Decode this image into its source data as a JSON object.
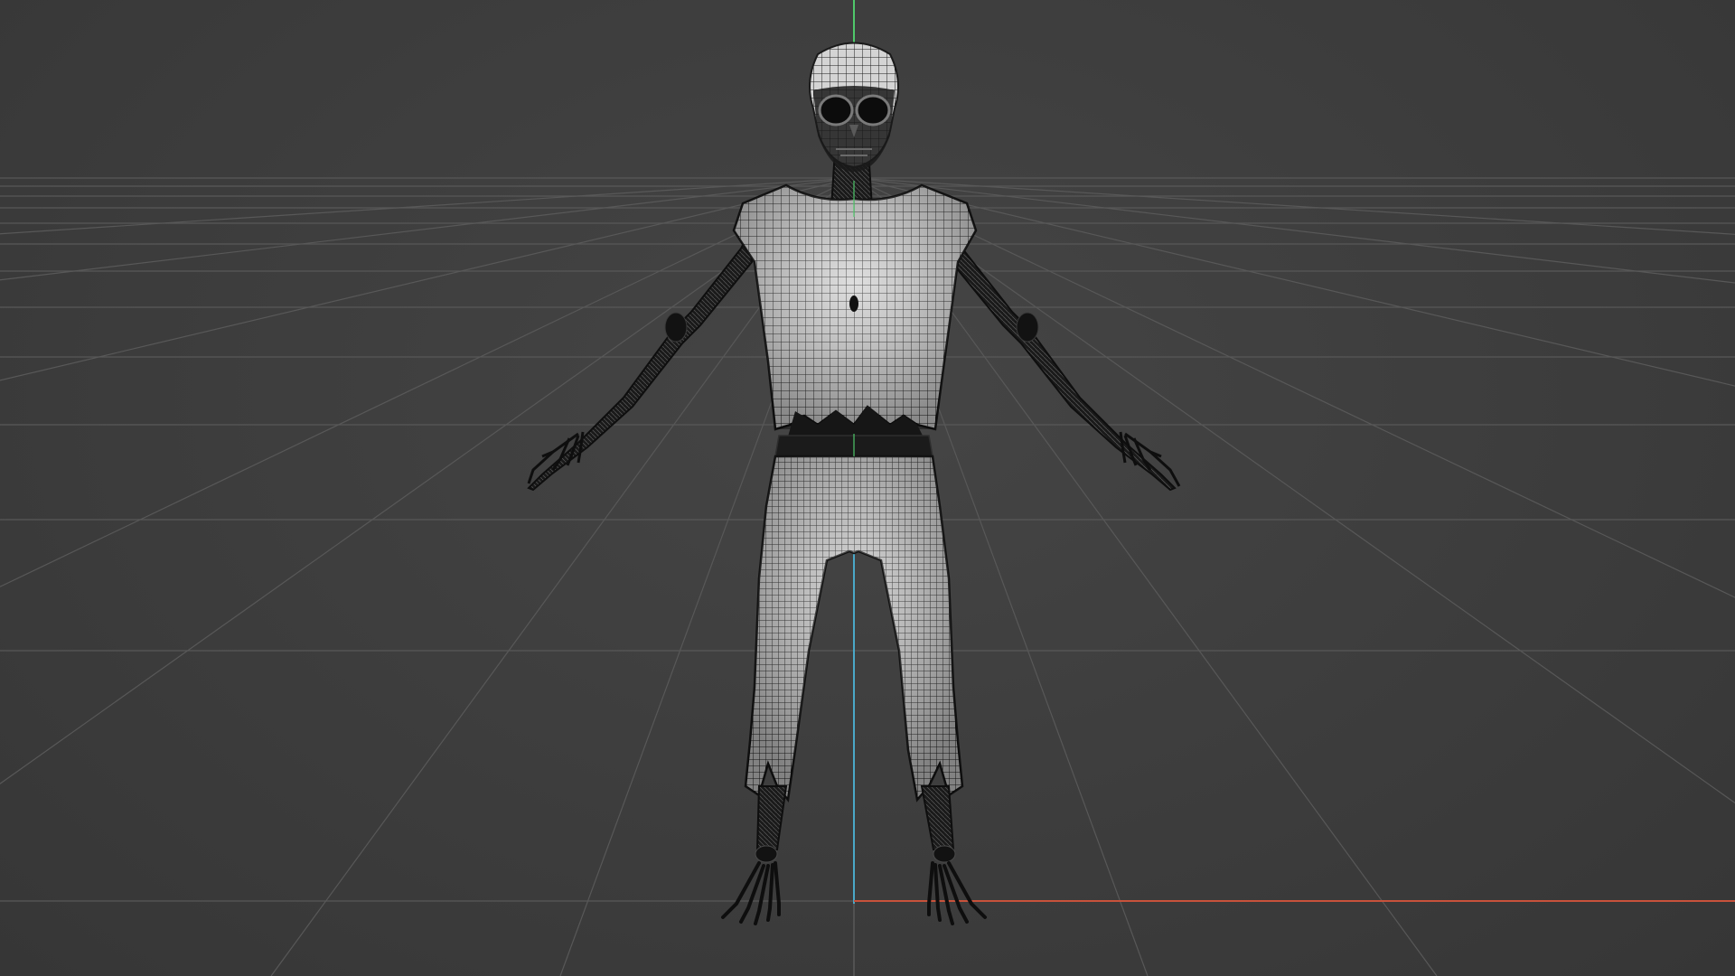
{
  "viewport": {
    "view": "front",
    "shading": "wireframe",
    "grid_visible": true,
    "colors": {
      "background": "#3d3d3d",
      "grid": "#5a5a5a",
      "axis_x": "#c8523b",
      "axis_y": "#4aa8c8",
      "axis_z": "#4fc86a",
      "mesh_fill": "#d9d9d9",
      "mesh_wire": "#1a1a1a",
      "bone": "#141414"
    }
  },
  "model": {
    "type": "skeleton-character",
    "parts": [
      "head",
      "shirt",
      "pants",
      "arms",
      "hands",
      "feet"
    ]
  }
}
